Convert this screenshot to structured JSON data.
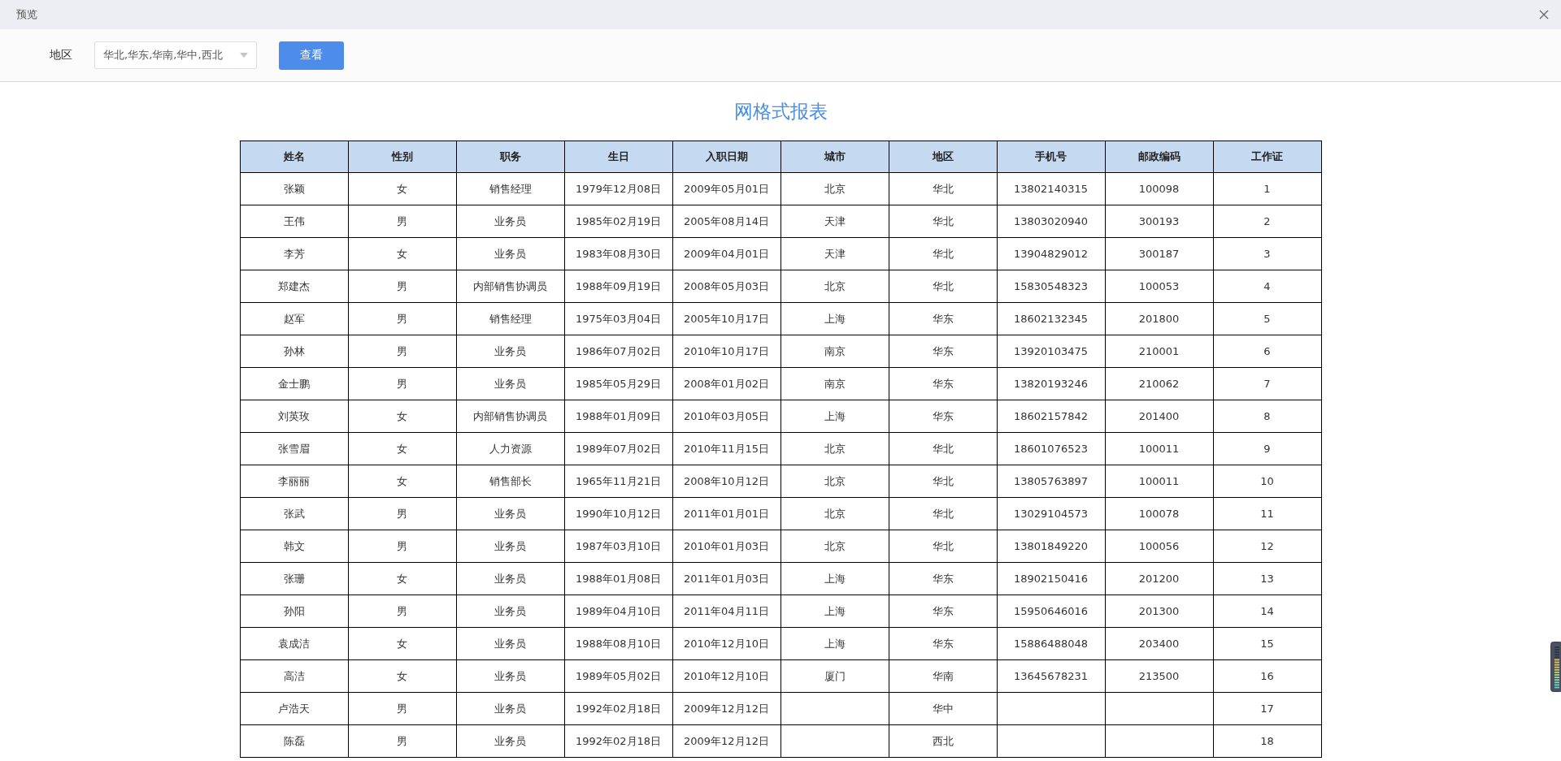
{
  "window": {
    "title": "预览"
  },
  "filter": {
    "label": "地区",
    "value": "华北,华东,华南,华中,西北",
    "button": "查看"
  },
  "report": {
    "title": "网格式报表",
    "columns": [
      "姓名",
      "性别",
      "职务",
      "生日",
      "入职日期",
      "城市",
      "地区",
      "手机号",
      "邮政编码",
      "工作证"
    ],
    "rows": [
      {
        "name": "张颖",
        "gender": "女",
        "position": "销售经理",
        "birthday": "1979年12月08日",
        "hire_date": "2009年05月01日",
        "city": "北京",
        "region": "华北",
        "phone": "13802140315",
        "postcode": "100098",
        "work_id": "1"
      },
      {
        "name": "王伟",
        "gender": "男",
        "position": "业务员",
        "birthday": "1985年02月19日",
        "hire_date": "2005年08月14日",
        "city": "天津",
        "region": "华北",
        "phone": "13803020940",
        "postcode": "300193",
        "work_id": "2"
      },
      {
        "name": "李芳",
        "gender": "女",
        "position": "业务员",
        "birthday": "1983年08月30日",
        "hire_date": "2009年04月01日",
        "city": "天津",
        "region": "华北",
        "phone": "13904829012",
        "postcode": "300187",
        "work_id": "3"
      },
      {
        "name": "郑建杰",
        "gender": "男",
        "position": "内部销售协调员",
        "birthday": "1988年09月19日",
        "hire_date": "2008年05月03日",
        "city": "北京",
        "region": "华北",
        "phone": "15830548323",
        "postcode": "100053",
        "work_id": "4"
      },
      {
        "name": "赵军",
        "gender": "男",
        "position": "销售经理",
        "birthday": "1975年03月04日",
        "hire_date": "2005年10月17日",
        "city": "上海",
        "region": "华东",
        "phone": "18602132345",
        "postcode": "201800",
        "work_id": "5"
      },
      {
        "name": "孙林",
        "gender": "男",
        "position": "业务员",
        "birthday": "1986年07月02日",
        "hire_date": "2010年10月17日",
        "city": "南京",
        "region": "华东",
        "phone": "13920103475",
        "postcode": "210001",
        "work_id": "6"
      },
      {
        "name": "金士鹏",
        "gender": "男",
        "position": "业务员",
        "birthday": "1985年05月29日",
        "hire_date": "2008年01月02日",
        "city": "南京",
        "region": "华东",
        "phone": "13820193246",
        "postcode": "210062",
        "work_id": "7"
      },
      {
        "name": "刘英玫",
        "gender": "女",
        "position": "内部销售协调员",
        "birthday": "1988年01月09日",
        "hire_date": "2010年03月05日",
        "city": "上海",
        "region": "华东",
        "phone": "18602157842",
        "postcode": "201400",
        "work_id": "8"
      },
      {
        "name": "张雪眉",
        "gender": "女",
        "position": "人力资源",
        "birthday": "1989年07月02日",
        "hire_date": "2010年11月15日",
        "city": "北京",
        "region": "华北",
        "phone": "18601076523",
        "postcode": "100011",
        "work_id": "9"
      },
      {
        "name": "李丽丽",
        "gender": "女",
        "position": "销售部长",
        "birthday": "1965年11月21日",
        "hire_date": "2008年10月12日",
        "city": "北京",
        "region": "华北",
        "phone": "13805763897",
        "postcode": "100011",
        "work_id": "10"
      },
      {
        "name": "张武",
        "gender": "男",
        "position": "业务员",
        "birthday": "1990年10月12日",
        "hire_date": "2011年01月01日",
        "city": "北京",
        "region": "华北",
        "phone": "13029104573",
        "postcode": "100078",
        "work_id": "11"
      },
      {
        "name": "韩文",
        "gender": "男",
        "position": "业务员",
        "birthday": "1987年03月10日",
        "hire_date": "2010年01月03日",
        "city": "北京",
        "region": "华北",
        "phone": "13801849220",
        "postcode": "100056",
        "work_id": "12"
      },
      {
        "name": "张珊",
        "gender": "女",
        "position": "业务员",
        "birthday": "1988年01月08日",
        "hire_date": "2011年01月03日",
        "city": "上海",
        "region": "华东",
        "phone": "18902150416",
        "postcode": "201200",
        "work_id": "13"
      },
      {
        "name": "孙阳",
        "gender": "男",
        "position": "业务员",
        "birthday": "1989年04月10日",
        "hire_date": "2011年04月11日",
        "city": "上海",
        "region": "华东",
        "phone": "15950646016",
        "postcode": "201300",
        "work_id": "14"
      },
      {
        "name": "袁成洁",
        "gender": "女",
        "position": "业务员",
        "birthday": "1988年08月10日",
        "hire_date": "2010年12月10日",
        "city": "上海",
        "region": "华东",
        "phone": "15886488048",
        "postcode": "203400",
        "work_id": "15"
      },
      {
        "name": "高洁",
        "gender": "女",
        "position": "业务员",
        "birthday": "1989年05月02日",
        "hire_date": "2010年12月10日",
        "city": "厦门",
        "region": "华南",
        "phone": "13645678231",
        "postcode": "213500",
        "work_id": "16"
      },
      {
        "name": "卢浩天",
        "gender": "男",
        "position": "业务员",
        "birthday": "1992年02月18日",
        "hire_date": "2009年12月12日",
        "region": "华中",
        "work_id": "17"
      },
      {
        "name": "陈磊",
        "gender": "男",
        "position": "业务员",
        "birthday": "1992年02月18日",
        "hire_date": "2009年12月12日",
        "region": "西北",
        "work_id": "18"
      }
    ]
  }
}
